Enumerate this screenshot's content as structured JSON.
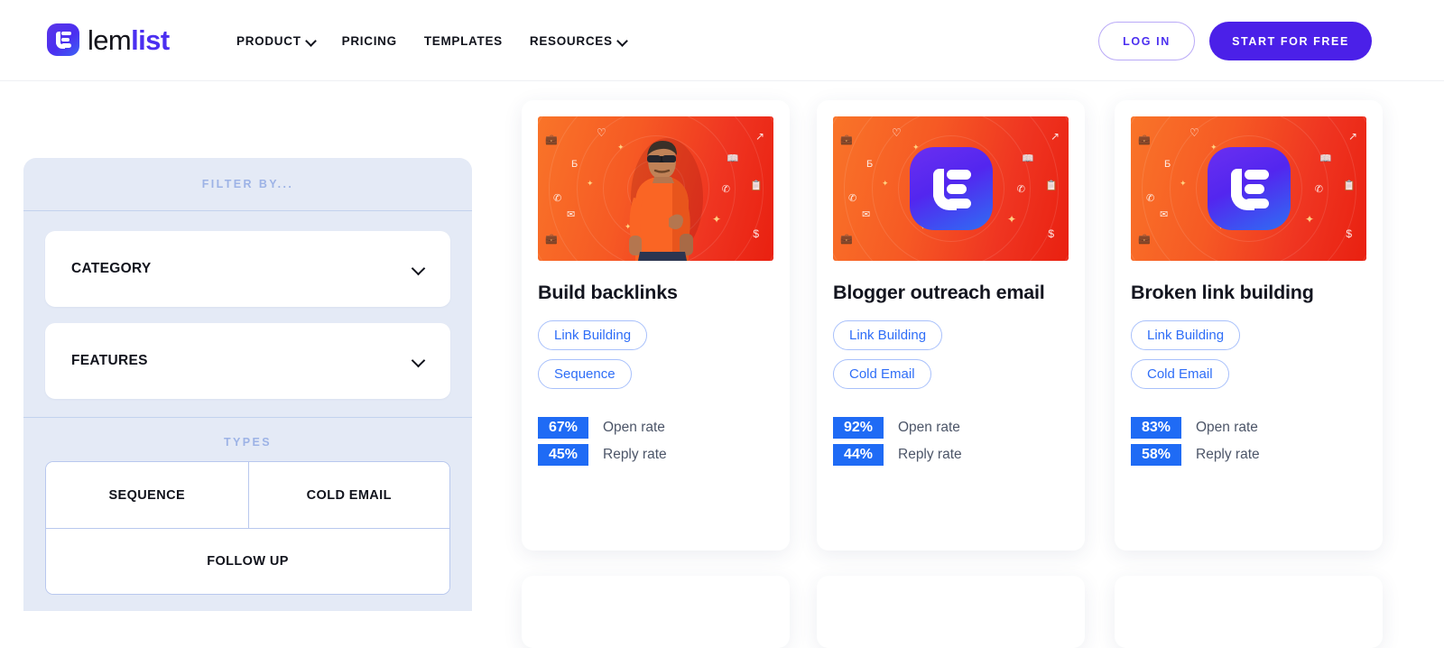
{
  "header": {
    "logo": {
      "part1": "lem",
      "part2": "list",
      "icon": "lemlist-logo-icon"
    },
    "nav": [
      {
        "label": "PRODUCT",
        "has_chevron": true
      },
      {
        "label": "PRICING",
        "has_chevron": false
      },
      {
        "label": "TEMPLATES",
        "has_chevron": false
      },
      {
        "label": "RESOURCES",
        "has_chevron": true
      }
    ],
    "login_label": "LOG IN",
    "start_label": "START FOR FREE",
    "accent_color": "#4b20e8"
  },
  "sidebar": {
    "filter_by_label": "FILTER BY...",
    "accordions": [
      {
        "label": "CATEGORY"
      },
      {
        "label": "FEATURES"
      }
    ],
    "types_label": "TYPES",
    "types": [
      {
        "label": "SEQUENCE"
      },
      {
        "label": "COLD EMAIL"
      },
      {
        "label": "FOLLOW UP"
      }
    ],
    "background_color": "#e4eaf6",
    "heading_color": "#9db3e6"
  },
  "cards": [
    {
      "title": "Build backlinks",
      "hero_type": "photo-person",
      "tags": [
        "Link Building",
        "Sequence"
      ],
      "stats": [
        {
          "value": "67%",
          "label": "Open rate"
        },
        {
          "value": "45%",
          "label": "Reply rate"
        }
      ]
    },
    {
      "title": "Blogger outreach email",
      "hero_type": "lemlist-logo",
      "tags": [
        "Link Building",
        "Cold Email"
      ],
      "stats": [
        {
          "value": "92%",
          "label": "Open rate"
        },
        {
          "value": "44%",
          "label": "Reply rate"
        }
      ]
    },
    {
      "title": "Broken link building",
      "hero_type": "lemlist-logo",
      "tags": [
        "Link Building",
        "Cold Email"
      ],
      "stats": [
        {
          "value": "83%",
          "label": "Open rate"
        },
        {
          "value": "58%",
          "label": "Reply rate"
        }
      ]
    }
  ],
  "hero_icons": [
    "briefcase",
    "heart",
    "trending-up",
    "bitcoin",
    "book",
    "phone-outgoing",
    "clipboard",
    "envelope",
    "dollar",
    "briefcase-2"
  ],
  "colors": {
    "stat_badge": "#1f6bf5",
    "tag_text": "#2f6ef7",
    "tag_border": "#a8c0fb",
    "hero_gradient_start": "#f97429",
    "hero_gradient_end": "#e92010"
  }
}
